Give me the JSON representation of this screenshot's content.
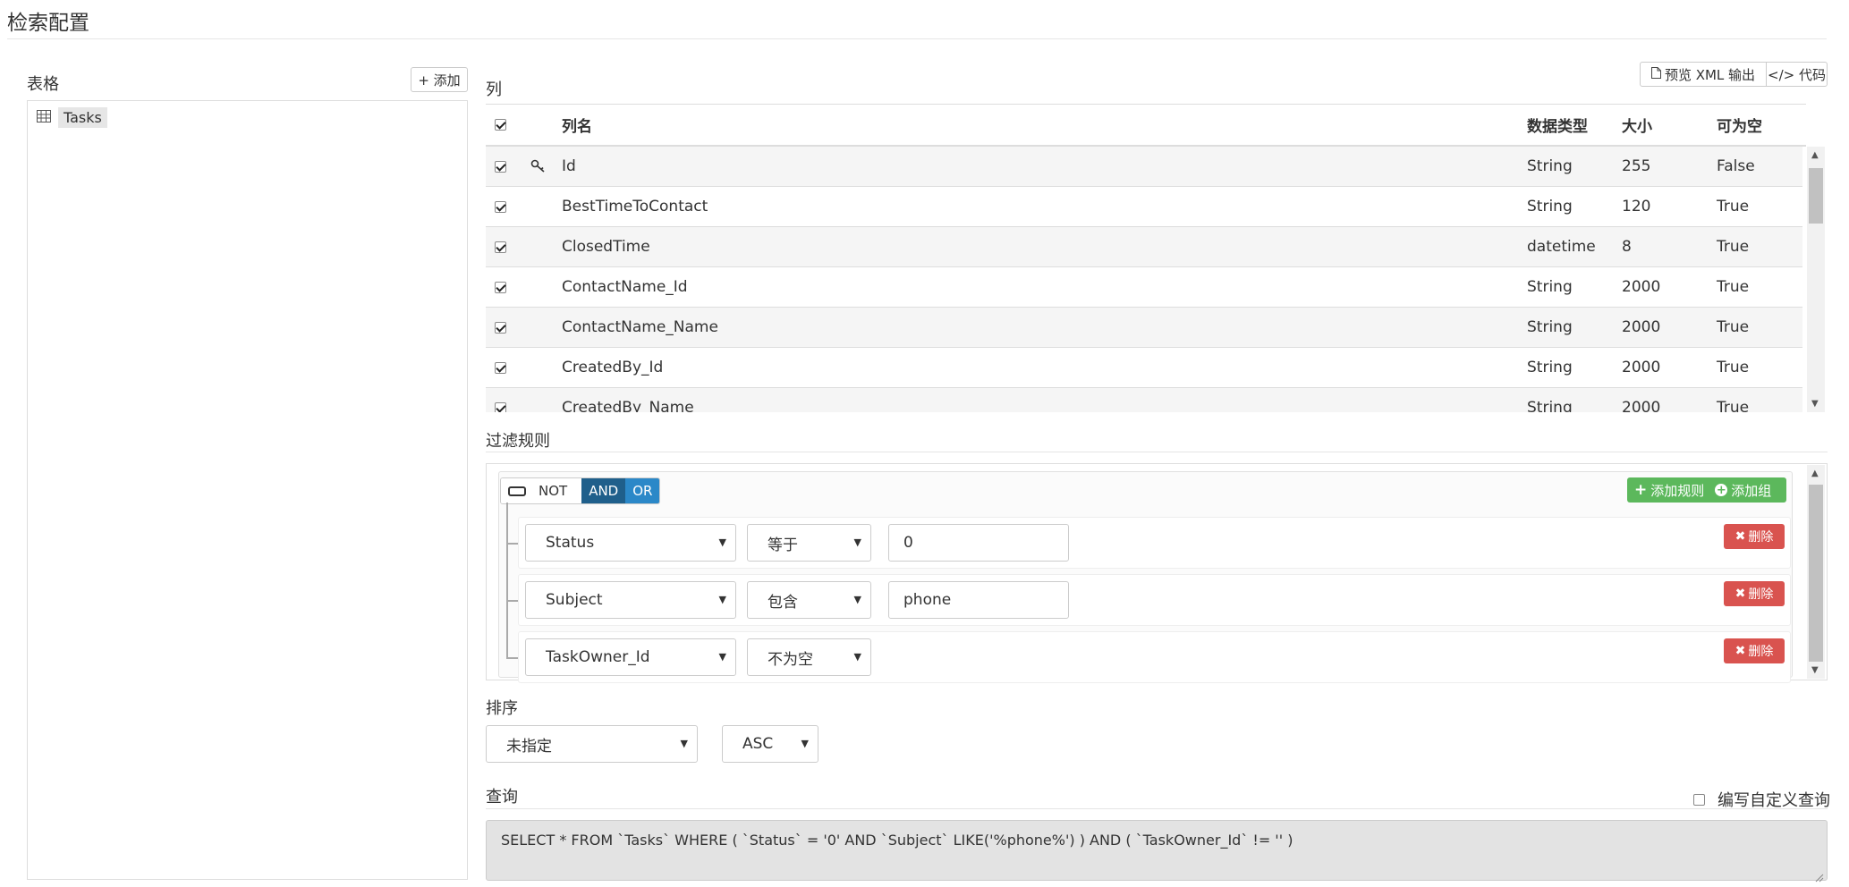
{
  "page": {
    "title": "检索配置"
  },
  "tables_section": {
    "label": "表格",
    "add_label": "+ 添加",
    "items": [
      {
        "label": "Tasks",
        "icon": "table-icon"
      }
    ]
  },
  "toolbar": {
    "preview_label": "预览 XML 输出",
    "code_label": "</> 代码"
  },
  "columns_section": {
    "label": "列",
    "headers": {
      "name": "列名",
      "type": "数据类型",
      "size": "大小",
      "nullable": "可为空"
    },
    "rows": [
      {
        "name": "Id",
        "type": "String",
        "size": "255",
        "nullable": "False",
        "checked": true,
        "key": true
      },
      {
        "name": "BestTimeToContact",
        "type": "String",
        "size": "120",
        "nullable": "True",
        "checked": true,
        "key": false
      },
      {
        "name": "ClosedTime",
        "type": "datetime",
        "size": "8",
        "nullable": "True",
        "checked": true,
        "key": false
      },
      {
        "name": "ContactName_Id",
        "type": "String",
        "size": "2000",
        "nullable": "True",
        "checked": true,
        "key": false
      },
      {
        "name": "ContactName_Name",
        "type": "String",
        "size": "2000",
        "nullable": "True",
        "checked": true,
        "key": false
      },
      {
        "name": "CreatedBy_Id",
        "type": "String",
        "size": "2000",
        "nullable": "True",
        "checked": true,
        "key": false
      },
      {
        "name": "CreatedBy_Name",
        "type": "String",
        "size": "2000",
        "nullable": "True",
        "checked": true,
        "key": false
      }
    ]
  },
  "filter_section": {
    "label": "过滤规则",
    "not_label": "NOT",
    "and_label": "AND",
    "or_label": "OR",
    "add_rule_label": "添加规则",
    "add_group_label": "添加组",
    "delete_label": "删除",
    "rules": [
      {
        "field": "Status",
        "operator": "等于",
        "value": "0"
      },
      {
        "field": "Subject",
        "operator": "包含",
        "value": "phone"
      },
      {
        "field": "TaskOwner_Id",
        "operator": "不为空",
        "value": ""
      }
    ]
  },
  "sort_section": {
    "label": "排序",
    "field": "未指定",
    "direction": "ASC"
  },
  "query_section": {
    "label": "查询",
    "custom_label": "编写自定义查询",
    "sql": "SELECT * FROM `Tasks` WHERE ( `Status` = '0' AND `Subject` LIKE('%phone%') )  AND ( `TaskOwner_Id` != '' )"
  },
  "colors": {
    "and_active": "#1f5f8b",
    "or": "#2b88c8",
    "green": "#5cb85c",
    "red": "#d9534f"
  }
}
